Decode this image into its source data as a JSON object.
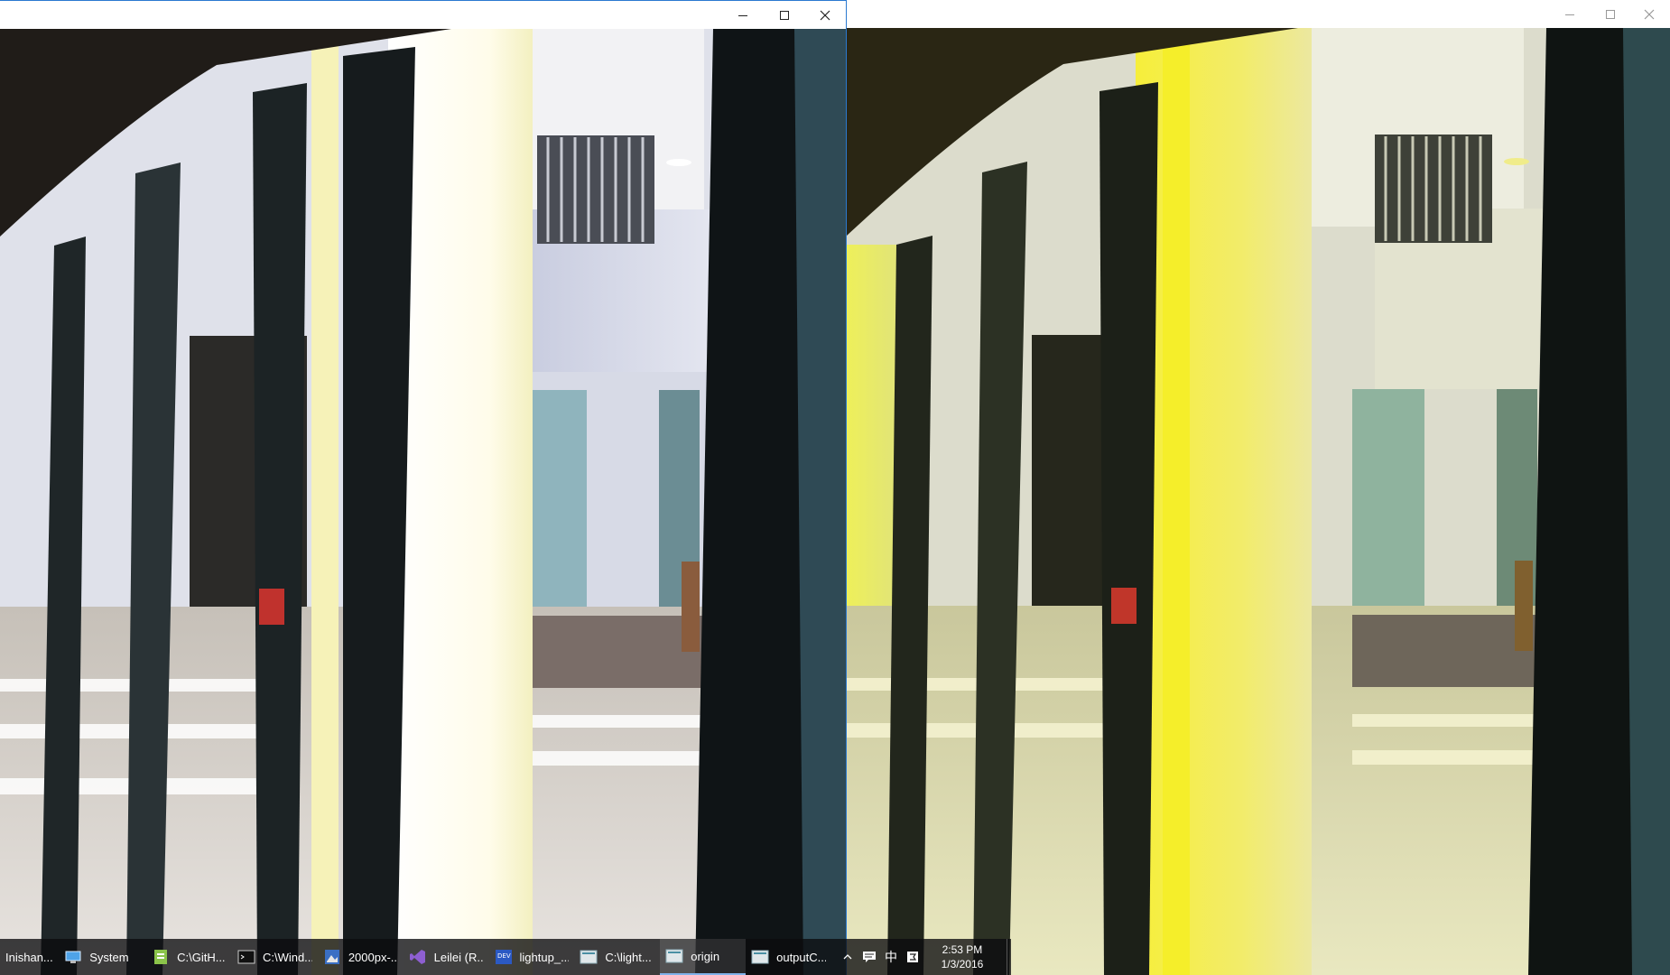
{
  "colors": {
    "taskbar_bg": "#0c0c0e",
    "accent_border": "#2b79d0",
    "titlebar": "#ffffff"
  },
  "left_window": {
    "controls": [
      "minimize-icon",
      "maximize-icon",
      "close-icon"
    ]
  },
  "right_window": {
    "controls": [
      "minimize-icon",
      "maximize-icon",
      "close-icon"
    ]
  },
  "taskbar": {
    "items": [
      {
        "label": "Inishan...",
        "icon": "explorer-icon"
      },
      {
        "label": "System",
        "icon": "system-icon"
      },
      {
        "label": "C:\\GitH...",
        "icon": "notepad-icon"
      },
      {
        "label": "C:\\Wind...",
        "icon": "console-icon"
      },
      {
        "label": "2000px-...",
        "icon": "image-viewer-icon"
      },
      {
        "label": "Leilei (R...",
        "icon": "visual-studio-icon"
      },
      {
        "label": "lightup_...",
        "icon": "dev-ide-icon"
      },
      {
        "label": "C:\\light...",
        "icon": "console-icon"
      },
      {
        "label": "origin",
        "icon": "image-window-icon"
      },
      {
        "label": "outputC...",
        "icon": "image-window-icon"
      }
    ],
    "active_index": 8,
    "tray": {
      "chevron": "chevron-up-icon",
      "message": "message-icon",
      "ime": "中",
      "ime_mode": "ime-mode-icon"
    },
    "clock": {
      "time": "2:53 PM",
      "date": "1/3/2016"
    }
  }
}
